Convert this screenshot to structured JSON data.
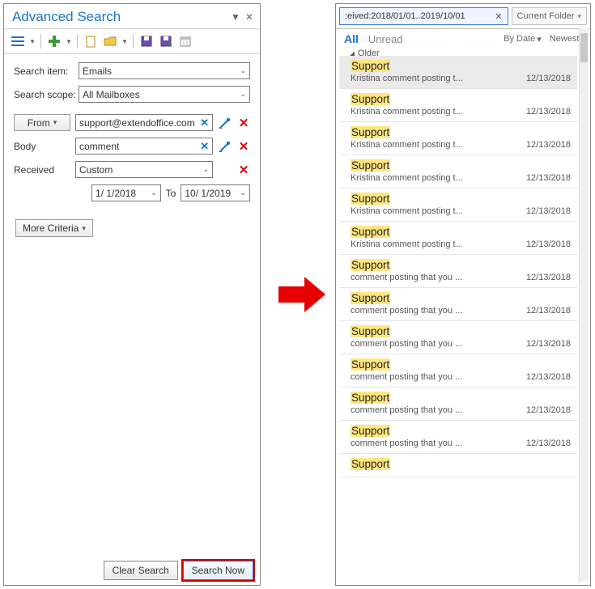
{
  "left": {
    "title": "Advanced Search",
    "toolbar_icons": [
      "list",
      "plus",
      "new-doc",
      "folder",
      "save",
      "save-as",
      "calendar"
    ],
    "search_item_label": "Search item:",
    "search_item_value": "Emails",
    "search_scope_label": "Search scope:",
    "search_scope_value": "All Mailboxes",
    "from_label": "From",
    "from_value": "support@extendoffice.com",
    "body_label": "Body",
    "body_value": "comment",
    "received_label": "Received",
    "received_value": "Custom",
    "date_from": "1/  1/2018",
    "date_to_label": "To",
    "date_to": "10/  1/2019",
    "more_criteria": "More Criteria",
    "clear_btn": "Clear Search",
    "search_btn": "Search Now"
  },
  "right": {
    "search_query": ":eived:2018/01/01..2019/10/01",
    "folder_scope": "Current Folder",
    "filter_all": "All",
    "filter_unread": "Unread",
    "sort_by": "By Date",
    "sort_dir": "Newest",
    "group_label": "Older",
    "messages": [
      {
        "sender": "Support",
        "subject": "Kristina comment posting t...",
        "date": "12/13/2018",
        "selected": true
      },
      {
        "sender": "Support",
        "subject": "Kristina comment posting t...",
        "date": "12/13/2018"
      },
      {
        "sender": "Support",
        "subject": "Kristina comment posting t...",
        "date": "12/13/2018"
      },
      {
        "sender": "Support",
        "subject": "Kristina comment posting t...",
        "date": "12/13/2018"
      },
      {
        "sender": "Support",
        "subject": "Kristina comment posting t...",
        "date": "12/13/2018"
      },
      {
        "sender": "Support",
        "subject": "Kristina comment posting t...",
        "date": "12/13/2018"
      },
      {
        "sender": "Support",
        "subject": "comment posting that you ...",
        "date": "12/13/2018"
      },
      {
        "sender": "Support",
        "subject": "comment posting that you ...",
        "date": "12/13/2018"
      },
      {
        "sender": "Support",
        "subject": "comment posting that you ...",
        "date": "12/13/2018"
      },
      {
        "sender": "Support",
        "subject": "comment posting that you ...",
        "date": "12/13/2018"
      },
      {
        "sender": "Support",
        "subject": "comment posting that you ...",
        "date": "12/13/2018"
      },
      {
        "sender": "Support",
        "subject": "comment posting that you ...",
        "date": "12/13/2018"
      },
      {
        "sender": "Support",
        "subject": "",
        "date": ""
      }
    ]
  }
}
